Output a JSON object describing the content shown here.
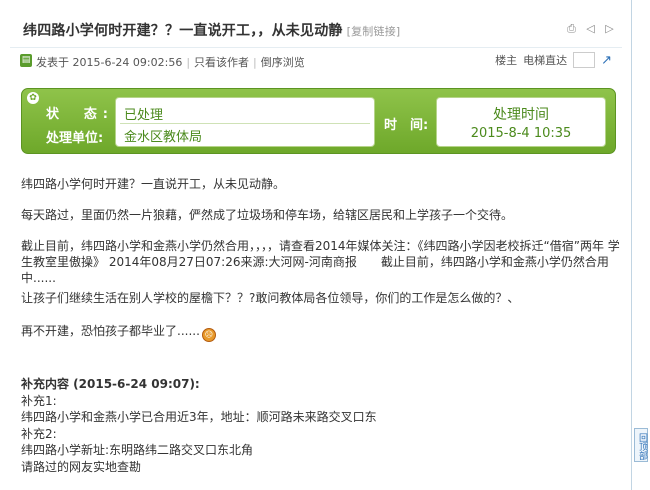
{
  "thread": {
    "title": "纬四路小学何时开建？？一直说开工，，从未见动静",
    "copy_link": "[复制链接]"
  },
  "meta": {
    "posted_at": "发表于 2015-6-24 09:02:56",
    "only_author": "只看该作者",
    "reverse_view": "倒序浏览",
    "floor_label": "楼主",
    "elevator_label": "电梯直达"
  },
  "status_panel": {
    "status_label": "状　态:",
    "unit_label": "处理单位:",
    "status_value": "已处理",
    "unit_value": "金水区教体局",
    "time_label": "时　间:",
    "time_title": "处理时间",
    "time_value": "2015-8-4 10:35"
  },
  "post": {
    "p1": "纬四路小学何时开建？一直说开工，从未见动静。",
    "p2": "每天路过，里面仍然一片狼藉，俨然成了垃圾场和停车场，给辖区居民和上学孩子一个交待。",
    "p3": "截止目前，纬四路小学和金燕小学仍然合用，，，，请查看2014年媒体关注：《纬四路小学因老校拆迁“借宿”两年 学生教室里傲操》 2014年08月27日07:26来源:大河网-河南商报　　截止目前，纬四路小学和金燕小学仍然合用中......",
    "p4": "让孩子们继续生活在别人学校的屋檐下？？?敢问教体局各位领导，你们的工作是怎么做的？、",
    "p5": "再不开建，恐怕孩子都毕业了......"
  },
  "supplement": {
    "heading": "补充内容 (2015-6-24 09:07):",
    "label1": "补充1:",
    "text1": "纬四路小学和金燕小学已合用近3年，地址：顺河路未来路交叉口东",
    "label2": "补充2:",
    "text2": "纬四路小学新址:东明路纬二路交叉口东北角",
    "text3": "请路过的网友实地查勘"
  },
  "back_to_top": "回顶部",
  "colors": {
    "panel_green": "#6ea82a",
    "value_green": "#4b8a1c",
    "link_blue": "#2b6fb6"
  }
}
